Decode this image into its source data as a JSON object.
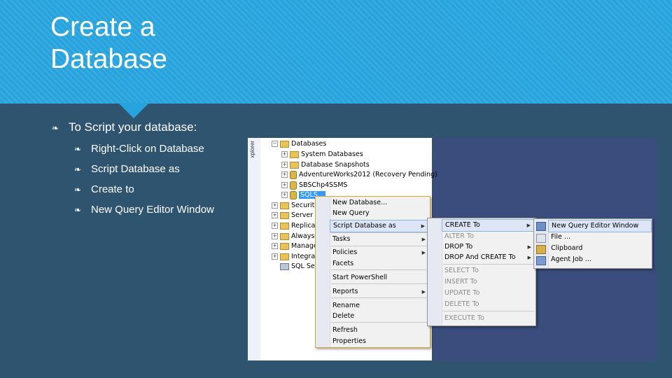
{
  "title": {
    "line1": "Create a",
    "line2": "Database"
  },
  "bullets": {
    "main": "To Script your database:",
    "sub": [
      "Right-Click on Database",
      "Script Database as",
      "Create to",
      "New Query Editor Window"
    ]
  },
  "screenshot": {
    "side_label": "xplorer",
    "tree": {
      "root": "Databases",
      "items": [
        "System Databases",
        "Database Snapshots",
        "AdventureWorks2012 (Recovery Pending)",
        "SBSChp4SSMS",
        "SQLS..."
      ],
      "lower_items": [
        "Security",
        "Server O",
        "Replicat",
        "AlwaysO",
        "Manager",
        "Integrati",
        "SQL Serv"
      ]
    },
    "context_menu": {
      "items": [
        "New Database...",
        "New Query",
        "Script Database as",
        "Tasks",
        "Policies",
        "Facets",
        "Start PowerShell",
        "Reports",
        "Rename",
        "Delete",
        "Refresh",
        "Properties"
      ]
    },
    "script_menu": {
      "items": [
        "CREATE To",
        "ALTER To",
        "DROP To",
        "DROP And CREATE To",
        "SELECT To",
        "INSERT To",
        "UPDATE To",
        "DELETE To",
        "EXECUTE To"
      ]
    },
    "target_menu": {
      "items": [
        "New Query Editor Window",
        "File ...",
        "Clipboard",
        "Agent Job ..."
      ]
    }
  },
  "colors": {
    "banner": "#27a3dd",
    "background": "#2e5470",
    "highlight": "#dce6f7"
  },
  "icons": {
    "bullet": "leaf-icon",
    "folder": "folder-icon",
    "database": "database-icon"
  }
}
